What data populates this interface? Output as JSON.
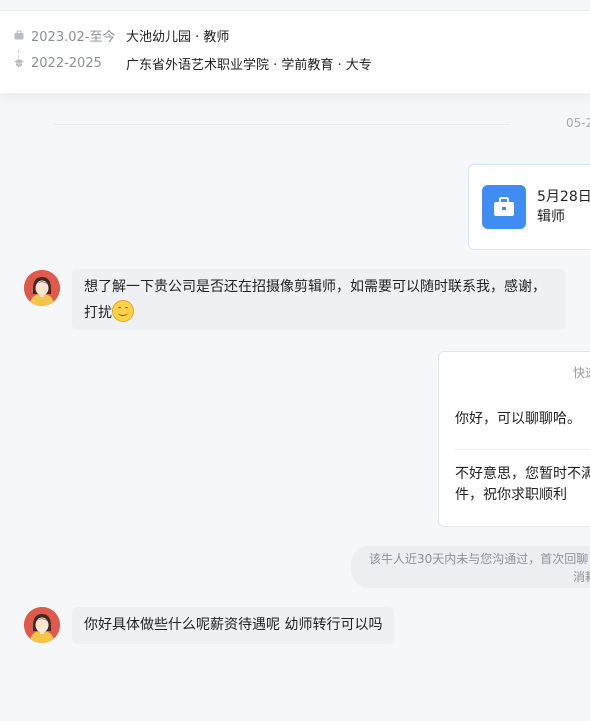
{
  "profile": {
    "experience": {
      "date": "2023.02-至今",
      "info": "大池幼儿园 · 教师"
    },
    "education": {
      "date": "2022-2025",
      "info": "广东省外语艺术职业学院 · 学前教育 · 大专"
    }
  },
  "chat": {
    "date_stamp": "05-2",
    "job_card": {
      "line1": "5月28日",
      "line2": "辑师"
    },
    "message1": {
      "line1": "想了解一下贵公司是否还在招摄像剪辑师，如需要可以随时联系我，感谢，",
      "line2": "打扰"
    },
    "quick_reply": {
      "title": "快速",
      "option1": "你好，可以聊聊哈。",
      "option2_line1": "不好意思，您暂时不满",
      "option2_line2": "件，祝你求职顺利"
    },
    "system_notice": {
      "line1": "该牛人近30天内未与您沟通过，首次回聊",
      "line2": "消耗"
    },
    "message2": {
      "text": "你好具体做些什么呢薪资待遇呢 幼师转行可以吗"
    }
  },
  "colors": {
    "accent": "#3f8cf2",
    "bubble": "#eef0f4",
    "background": "#f6f7f9"
  },
  "icons": [
    "briefcase-small-icon",
    "graduation-cap-icon",
    "briefcase-icon",
    "smile-emoji-icon",
    "user-avatar"
  ]
}
